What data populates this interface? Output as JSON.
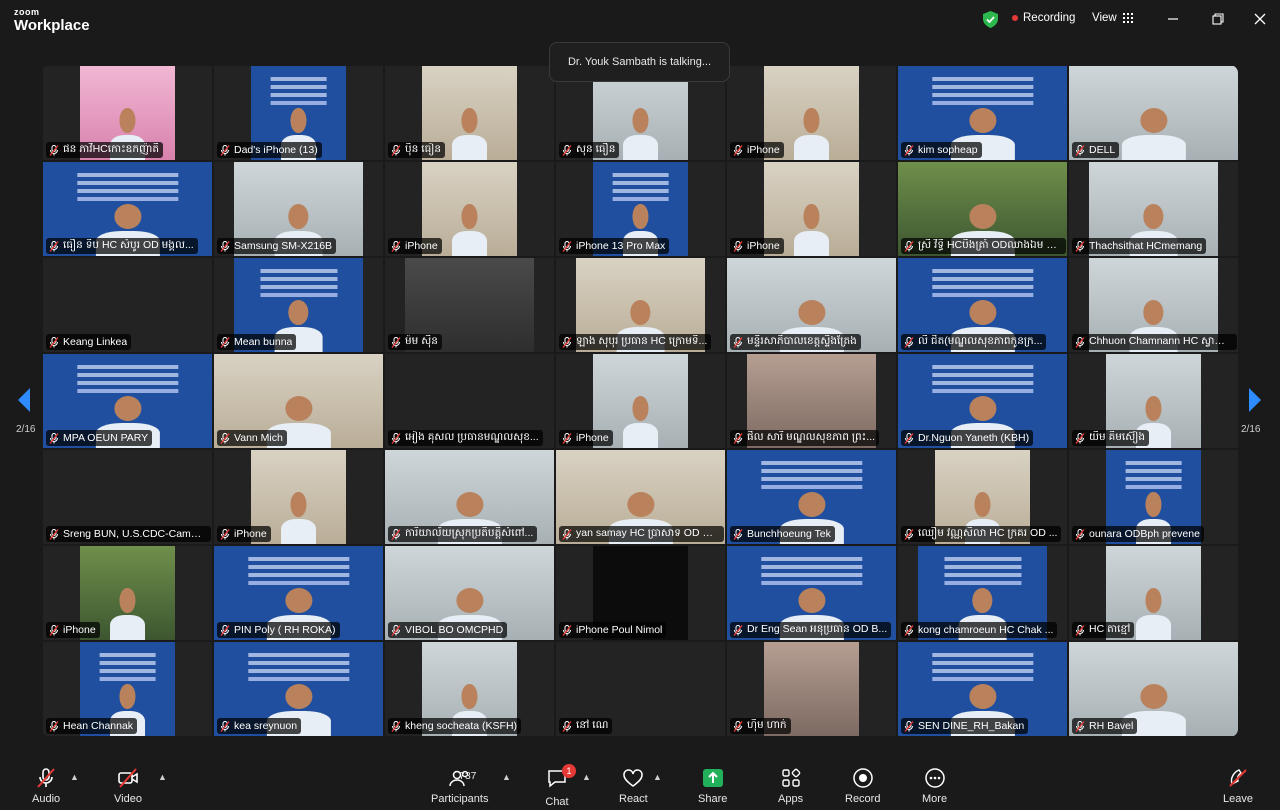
{
  "app": {
    "brand_small": "zoom",
    "brand_large": "Workplace"
  },
  "header": {
    "recording_label": "Recording",
    "view_label": "View"
  },
  "talking": "Dr. Youk Sambath is talking...",
  "pagination": {
    "left": "2/16",
    "right": "2/16"
  },
  "colors": {
    "accent": "#0e72ed",
    "record": "#e53935",
    "shield": "#2db84d",
    "share": "#20b15a",
    "banner": "#1f4f9e"
  },
  "tiles": [
    {
      "name": "ផន ភាវីHCកោះឧកញ៉ាតី",
      "style": "pink",
      "w": "narrow"
    },
    {
      "name": "Dad's iPhone (13)",
      "style": "banner",
      "w": "narrow"
    },
    {
      "name": "ប៉ិន ធៀន",
      "style": "room",
      "w": "narrow"
    },
    {
      "name": "សុន ធឿន",
      "style": "office",
      "w": "narrow"
    },
    {
      "name": "iPhone",
      "style": "room",
      "w": "narrow"
    },
    {
      "name": "kim sopheap",
      "style": "banner",
      "w": "full"
    },
    {
      "name": "DELL",
      "style": "office",
      "w": "full"
    },
    {
      "name": "ធឿន ទិប HC សំបូរ OD មង្គល...",
      "style": "banner",
      "w": "full"
    },
    {
      "name": "Samsung SM-X216B",
      "style": "office",
      "w": "mid"
    },
    {
      "name": "iPhone",
      "style": "room",
      "w": "narrow"
    },
    {
      "name": "iPhone 13 Pro Max",
      "style": "banner",
      "w": "narrow"
    },
    {
      "name": "iPhone",
      "style": "room",
      "w": "narrow"
    },
    {
      "name": "ស្រី វិទ្ធី HCបឹងត្រាំ ODឈាងឯម PH...",
      "style": "green",
      "w": "full"
    },
    {
      "name": "Thachsithat HCmemang",
      "style": "office",
      "w": "mid"
    },
    {
      "name": "Keang Linkea",
      "style": "gray",
      "w": "none"
    },
    {
      "name": "Mean bunna",
      "style": "banner",
      "w": "mid"
    },
    {
      "name": "ម៉ម ស៊ីន",
      "style": "gray",
      "w": "mid"
    },
    {
      "name": "ឡាង សុបុរ ប្រធាន HC ក្រោមទឹ...",
      "style": "room",
      "w": "mid"
    },
    {
      "name": "មន្ទីរសាភិបាលខេត្តស្ទឹងត្រែង",
      "style": "office",
      "w": "full"
    },
    {
      "name": "លី ជិត(មណ្ឌលសុខភាពកូនក្រ...",
      "style": "banner",
      "w": "full"
    },
    {
      "name": "Chhuon Chamnann HC ស្វាយ...",
      "style": "office",
      "w": "mid"
    },
    {
      "name": "MPA OEUN PARY",
      "style": "banner",
      "w": "full"
    },
    {
      "name": "Vann Mich",
      "style": "room",
      "w": "full"
    },
    {
      "name": "អៀង គុសល ប្រធានមណ្ឌលសុខ...",
      "style": "gray",
      "w": "none"
    },
    {
      "name": "iPhone",
      "style": "office",
      "w": "narrow"
    },
    {
      "name": "ផិល សារី មណ្ឌលសុខភាព ព្រះ...",
      "style": "blur",
      "w": "mid"
    },
    {
      "name": "Dr.Nguon Yaneth (KBH)",
      "style": "banner",
      "w": "full"
    },
    {
      "name": "យឹម គឹមស៊ៀង",
      "style": "office",
      "w": "narrow"
    },
    {
      "name": "Sreng BUN, U.S.CDC-Cambodia",
      "style": "dark",
      "w": "none"
    },
    {
      "name": "iPhone",
      "style": "room",
      "w": "narrow"
    },
    {
      "name": "ការិយាល័យស្រុកប្រតិបត្តិសំពៅ...",
      "style": "office",
      "w": "full"
    },
    {
      "name": "yan samay HC ប្រាសាទ OD ព្រ...",
      "style": "room",
      "w": "full"
    },
    {
      "name": "Bunchhoeung Tek",
      "style": "banner",
      "w": "full"
    },
    {
      "name": "ឈឿម វណ្ណសិលា HC ក្រគរ OD ...",
      "style": "room",
      "w": "narrow"
    },
    {
      "name": "ounara ODBph prevene",
      "style": "banner",
      "w": "narrow"
    },
    {
      "name": "iPhone",
      "style": "green",
      "w": "narrow"
    },
    {
      "name": "PIN Poly ( RH ROKA)",
      "style": "banner",
      "w": "full"
    },
    {
      "name": "VIBOL BO OMCPHD",
      "style": "office",
      "w": "full"
    },
    {
      "name": "iPhone Poul Nimol",
      "style": "dark",
      "w": "narrow"
    },
    {
      "name": "Dr Eng Sean អនុប្រធាន OD B...",
      "style": "banner",
      "w": "full"
    },
    {
      "name": "kong chamroeun   HC  Chak ...",
      "style": "banner",
      "w": "mid"
    },
    {
      "name": "HC តាខ្មៅ",
      "style": "office",
      "w": "narrow"
    },
    {
      "name": "Hean Channak",
      "style": "banner",
      "w": "narrow"
    },
    {
      "name": "kea sreynuon",
      "style": "banner",
      "w": "full"
    },
    {
      "name": "kheng socheata (KSFH)",
      "style": "office",
      "w": "narrow"
    },
    {
      "name": "នៅ ណេ",
      "style": "gray",
      "w": "none"
    },
    {
      "name": "ហ៊ឹម ហាក់",
      "style": "blur",
      "w": "narrow"
    },
    {
      "name": "SEN DINE_RH_Bakan",
      "style": "banner",
      "w": "full"
    },
    {
      "name": "RH Bavel",
      "style": "office",
      "w": "full"
    }
  ],
  "toolbar": {
    "audio": "Audio",
    "video": "Video",
    "participants": "Participants",
    "participants_count": "737",
    "chat": "Chat",
    "chat_badge": "1",
    "react": "React",
    "share": "Share",
    "apps": "Apps",
    "record": "Record",
    "more": "More",
    "leave": "Leave"
  },
  "icons": [
    "shield-icon",
    "grid-icon",
    "minimize-icon",
    "restore-icon",
    "close-icon",
    "mic-muted-icon",
    "video-off-icon",
    "participants-icon",
    "chat-icon",
    "heart-icon",
    "share-arrow-icon",
    "apps-icon",
    "record-icon",
    "more-icon",
    "leave-icon",
    "arrow-left-icon",
    "arrow-right-icon"
  ]
}
